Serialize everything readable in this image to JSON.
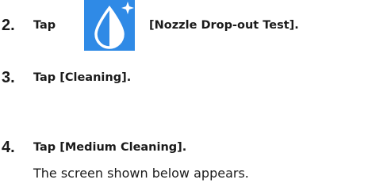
{
  "steps": [
    {
      "number": "2.",
      "text_before": "Tap",
      "icon": "nozzle-drop-out-test-icon",
      "text_after": "[Nozzle Drop-out Test]."
    },
    {
      "number": "3.",
      "text": "Tap [Cleaning]."
    },
    {
      "number": "4.",
      "text": "Tap [Medium Cleaning].",
      "subtext": "The screen shown below appears."
    }
  ],
  "colors": {
    "icon_background": "#2f8ae6",
    "icon_glyph": "#ffffff",
    "text": "#1a1a1a"
  }
}
